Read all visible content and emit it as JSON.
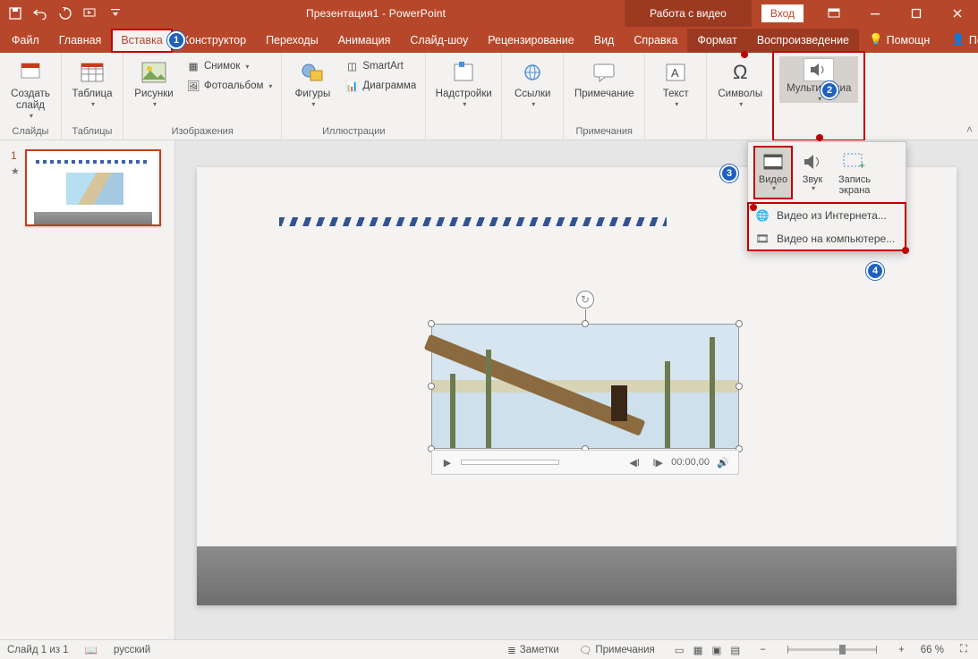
{
  "titlebar": {
    "doc_title": "Презентация1 - PowerPoint",
    "context_title": "Работа с видео",
    "login": "Вход"
  },
  "tabs": {
    "items": [
      "Файл",
      "Главная",
      "Вставка",
      "Конструктор",
      "Переходы",
      "Анимация",
      "Слайд-шоу",
      "Рецензирование",
      "Вид",
      "Справка"
    ],
    "context_items": [
      "Формат",
      "Воспроизведение"
    ],
    "active": "Вставка",
    "help": "Помощн",
    "share": "Поделиться"
  },
  "ribbon": {
    "groups": {
      "slides": {
        "label": "Слайды",
        "new_slide": "Создать\nслайд"
      },
      "tables": {
        "label": "Таблицы",
        "table": "Таблица"
      },
      "images": {
        "label": "Изображения",
        "pictures": "Рисунки",
        "screenshot": "Снимок",
        "album": "Фотоальбом"
      },
      "illustr": {
        "label": "Иллюстрации",
        "shapes": "Фигуры",
        "smartart": "SmartArt",
        "chart": "Диаграмма"
      },
      "addins": {
        "label": "",
        "addins": "Надстройки"
      },
      "links": {
        "label": "",
        "links": "Ссылки"
      },
      "comments": {
        "label": "Примечания",
        "comment": "Примечание"
      },
      "text": {
        "label": "",
        "text": "Текст"
      },
      "symbols": {
        "label": "",
        "symbols": "Символы"
      },
      "media": {
        "label": "",
        "media": "Мультимедиа"
      }
    }
  },
  "media_dropdown": {
    "video": "Видео",
    "audio": "Звук",
    "screenrec": "Запись\nэкрана",
    "from_web": "Видео из Интернета...",
    "from_pc": "Видео на компьютере..."
  },
  "thumbs": {
    "current": "1"
  },
  "video_controls": {
    "time": "00:00,00"
  },
  "status": {
    "slide_of": "Слайд 1 из 1",
    "lang": "русский",
    "notes": "Заметки",
    "comments": "Примечания",
    "zoom": "66 %"
  },
  "callouts": {
    "c1": "1",
    "c2": "2",
    "c3": "3",
    "c4": "4"
  }
}
